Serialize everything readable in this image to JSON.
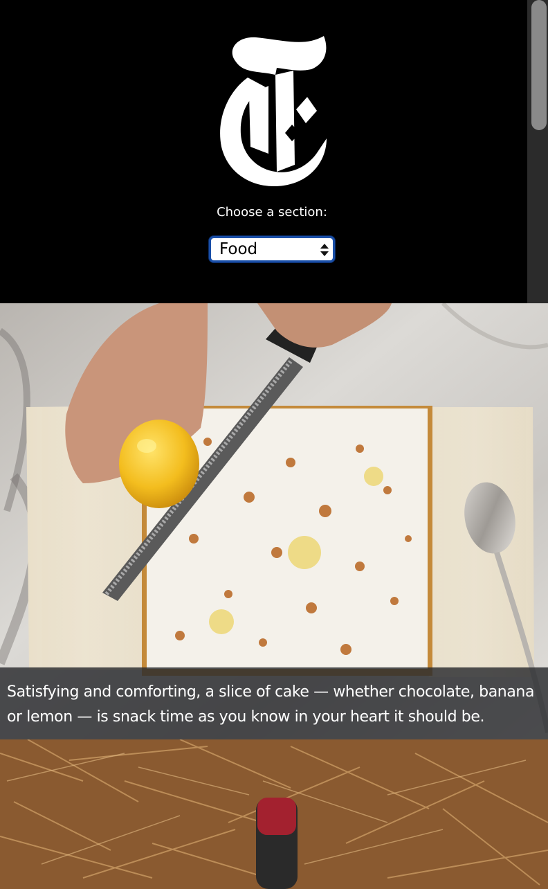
{
  "header": {
    "logo_letter": "T",
    "section_prompt": "Choose a section:",
    "section_select": {
      "selected": "Food"
    }
  },
  "hero": {
    "caption": "Satisfying and comforting, a slice of cake — whether chocolate, banana or lemon — is snack time as you know in your heart it should be."
  },
  "icons": {
    "logo": "nyt-t-logo-icon",
    "select_arrows": "updown-arrows-icon"
  }
}
